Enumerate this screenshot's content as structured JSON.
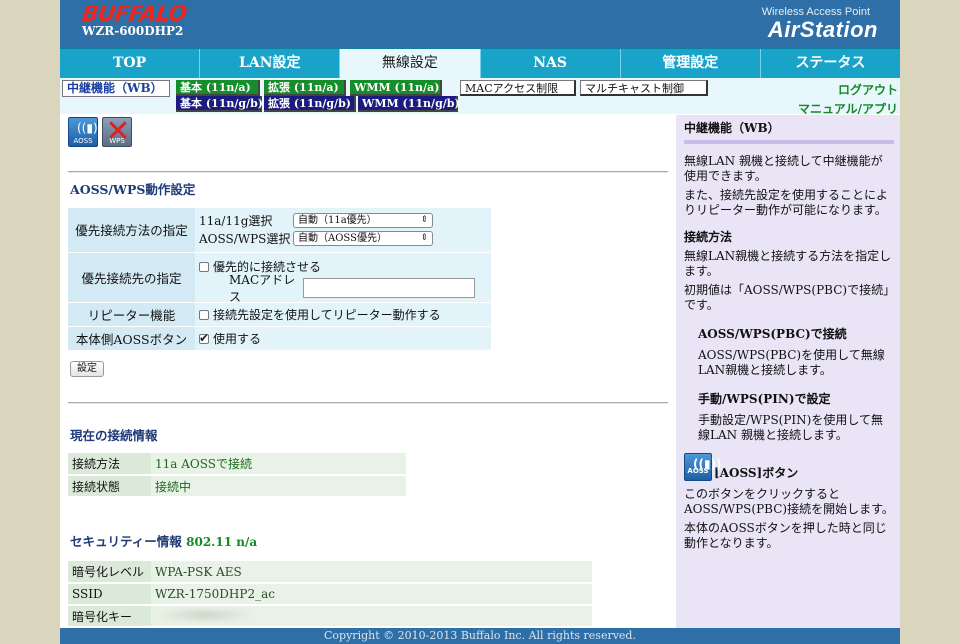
{
  "header": {
    "logo": "BUFFALO",
    "model": "WZR-600DHP2",
    "brand_sub": "Wireless Access Point",
    "brand": "AirStation"
  },
  "nav": {
    "tabs": [
      "TOP",
      "LAN設定",
      "無線設定",
      "NAS",
      "管理設定",
      "ステータス"
    ],
    "active": "無線設定"
  },
  "subnav": {
    "current": "中継機能（WB）",
    "row1": [
      "基本 (11n/a)",
      "拡張 (11n/a)",
      "WMM (11n/a)",
      "MACアクセス制限",
      "マルチキャスト制御"
    ],
    "row2": [
      "基本 (11n/g/b)",
      "拡張 (11n/g/b)",
      "WMM (11n/g/b)"
    ],
    "logout": "ログアウト",
    "manual": "マニュアル/アプリ"
  },
  "icons": {
    "aoss_label": "AOSS",
    "wps_label": "WPS"
  },
  "aoss_section": {
    "title": "AOSS/WPS動作設定",
    "priority_method_label": "優先接続方法の指定",
    "band_select_label": "11a/11g選択",
    "band_select_value": "自動（11a優先）",
    "aoss_wps_select_label": "AOSS/WPS選択",
    "aoss_wps_select_value": "自動（AOSS優先）",
    "priority_target_label": "優先接続先の指定",
    "priority_connect_checkbox": "優先的に接続させる",
    "mac_address_label": "MACアドレス",
    "mac_address_value": "",
    "repeater_label": "リピーター機能",
    "repeater_checkbox": "接続先設定を使用してリピーター動作する",
    "aoss_button_label": "本体側AOSSボタン",
    "aoss_button_checkbox": "使用する",
    "set_button": "設定"
  },
  "connection_info": {
    "title": "現在の接続情報",
    "rows": [
      {
        "key": "接続方法",
        "value": "11a AOSSで接続"
      },
      {
        "key": "接続状態",
        "value": "接続中"
      }
    ]
  },
  "security_info": {
    "title": "セキュリティー情報",
    "standard": "802.11 n/a",
    "rows": [
      {
        "key": "暗号化レベル",
        "value": "WPA-PSK AES"
      },
      {
        "key": "SSID",
        "value": "WZR-1750DHP2_ac"
      },
      {
        "key": "暗号化キー",
        "value": ""
      }
    ]
  },
  "help": {
    "title": "中継機能（WB）",
    "intro": "無線LAN 親機と接続して中継機能が使用できます。",
    "intro2": "また、接続先設定を使用することによりリピーター動作が可能になります。",
    "method_title": "接続方法",
    "method_text": "無線LAN親機と接続する方法を指定します。",
    "method_default": "初期値は「AOSS/WPS(PBC)で接続」です。",
    "pbc_title": "AOSS/WPS(PBC)で接続",
    "pbc_text": "AOSS/WPS(PBC)を使用して無線LAN親機と接続します。",
    "pin_title": "手動/WPS(PIN)で設定",
    "pin_text": "手動設定/WPS(PIN)を使用して無線LAN 親機と接続します。",
    "aoss_button_title": "[AOSS]ボタン",
    "aoss_button_text": "このボタンをクリックするとAOSS/WPS(PBC)接続を開始します。",
    "aoss_button_text2": "本体のAOSSボタンを押した時と同じ動作となります。"
  },
  "footer": "Copyright © 2010-2013 Buffalo Inc. All rights reserved."
}
